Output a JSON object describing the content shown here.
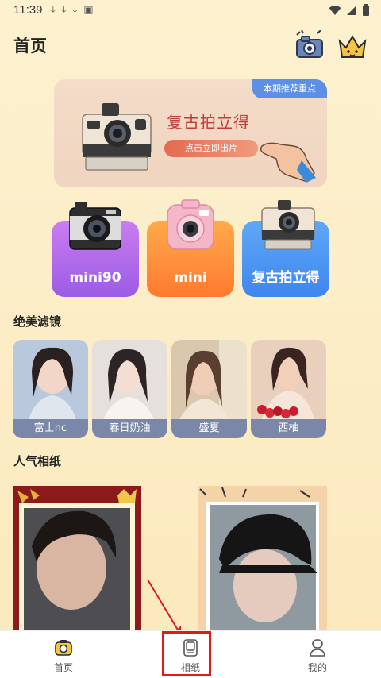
{
  "status_bar": {
    "time": "11:39"
  },
  "header": {
    "title": "首页"
  },
  "banner": {
    "tag": "本期推荐重点",
    "title": "复古拍立得",
    "button_label": "点击立即出片"
  },
  "cameras": [
    {
      "label": "mini90",
      "gradient_from": "#c97df0",
      "gradient_to": "#9b5be6"
    },
    {
      "label": "mini",
      "gradient_from": "#ffa94d",
      "gradient_to": "#ff7a2e"
    },
    {
      "label": "复古拍立得",
      "gradient_from": "#5fa8f7",
      "gradient_to": "#3e86ef"
    }
  ],
  "filters_section": {
    "title": "绝美滤镜",
    "items": [
      {
        "label": "富士nc"
      },
      {
        "label": "春日奶油"
      },
      {
        "label": "盛夏"
      },
      {
        "label": "西柚"
      }
    ]
  },
  "papers_section": {
    "title": "人气相纸"
  },
  "bottom_nav": [
    {
      "label": "首页",
      "icon": "camera-icon",
      "active": true
    },
    {
      "label": "相纸",
      "icon": "photo-paper-icon",
      "active": false
    },
    {
      "label": "我的",
      "icon": "profile-icon",
      "active": false
    }
  ],
  "colors": {
    "background": "#fdf1cf",
    "banner_title": "#c53a3a",
    "tag_blue": "#5d8fe6",
    "filter_label": "#7a87a8",
    "highlight_red": "#e0191b"
  }
}
